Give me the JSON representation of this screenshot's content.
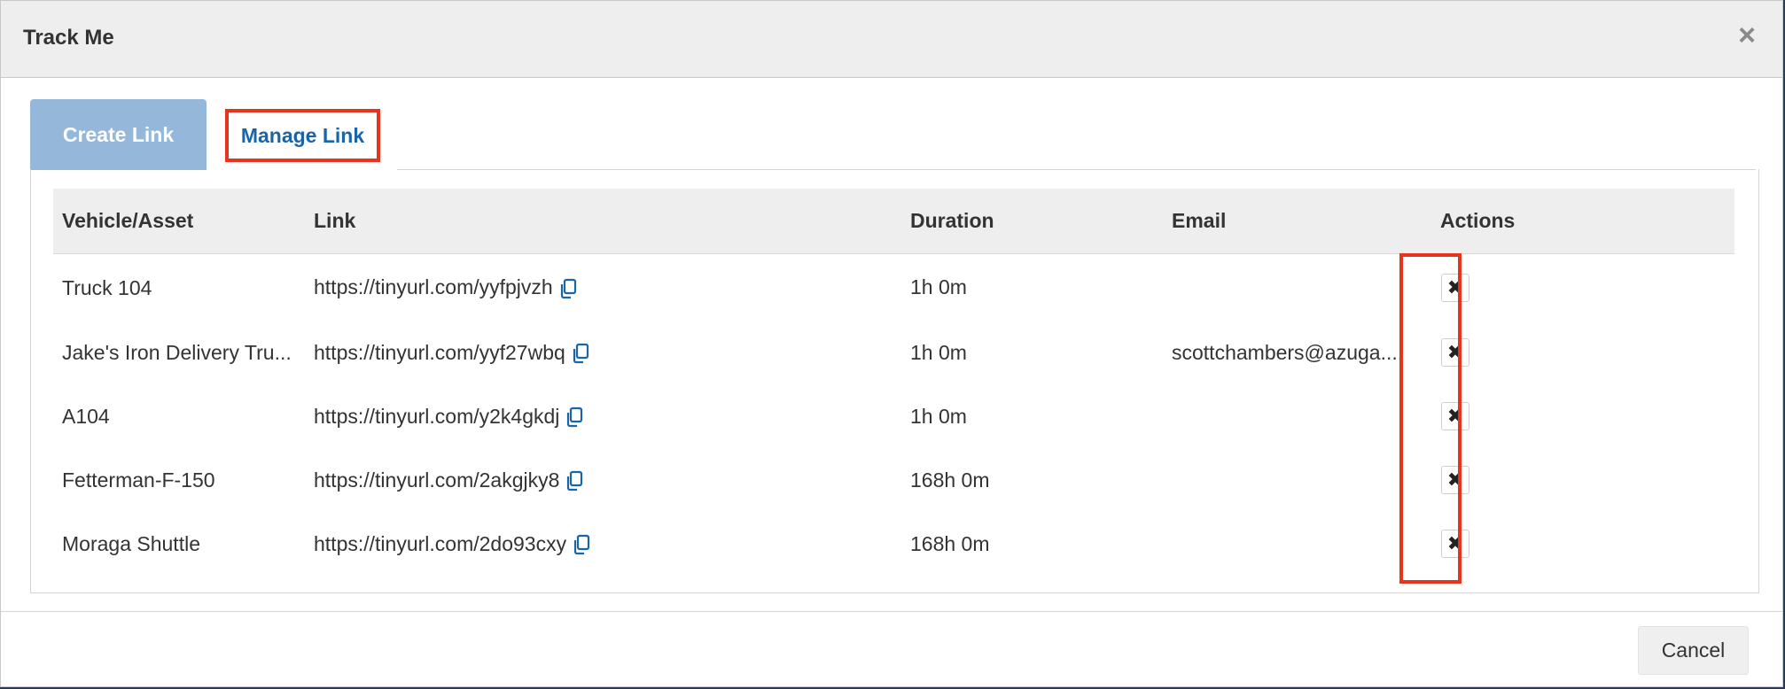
{
  "modal": {
    "title": "Track Me",
    "close_icon": "close-icon"
  },
  "tabs": [
    {
      "label": "Create Link",
      "active": false
    },
    {
      "label": "Manage Link",
      "active": true
    }
  ],
  "table": {
    "headers": [
      "Vehicle/Asset",
      "Link",
      "Duration",
      "Email",
      "Actions"
    ],
    "rows": [
      {
        "vehicle": "Truck 104",
        "link": "https://tinyurl.com/yyfpjvzh",
        "duration": "1h 0m",
        "email": ""
      },
      {
        "vehicle": "Jake's Iron Delivery Tru...",
        "link": "https://tinyurl.com/yyf27wbq",
        "duration": "1h 0m",
        "email": "scottchambers@azuga...."
      },
      {
        "vehicle": "A104",
        "link": "https://tinyurl.com/y2k4gkdj",
        "duration": "1h 0m",
        "email": ""
      },
      {
        "vehicle": "Fetterman-F-150",
        "link": "https://tinyurl.com/2akgjky8",
        "duration": "168h 0m",
        "email": ""
      },
      {
        "vehicle": "Moraga Shuttle",
        "link": "https://tinyurl.com/2do93cxy",
        "duration": "168h 0m",
        "email": ""
      }
    ],
    "delete_symbol": "✖"
  },
  "footer": {
    "cancel_label": "Cancel"
  },
  "colors": {
    "accent_link": "#1a64a8",
    "active_tab_bg": "#95b8da",
    "highlight": "#e8341c"
  }
}
